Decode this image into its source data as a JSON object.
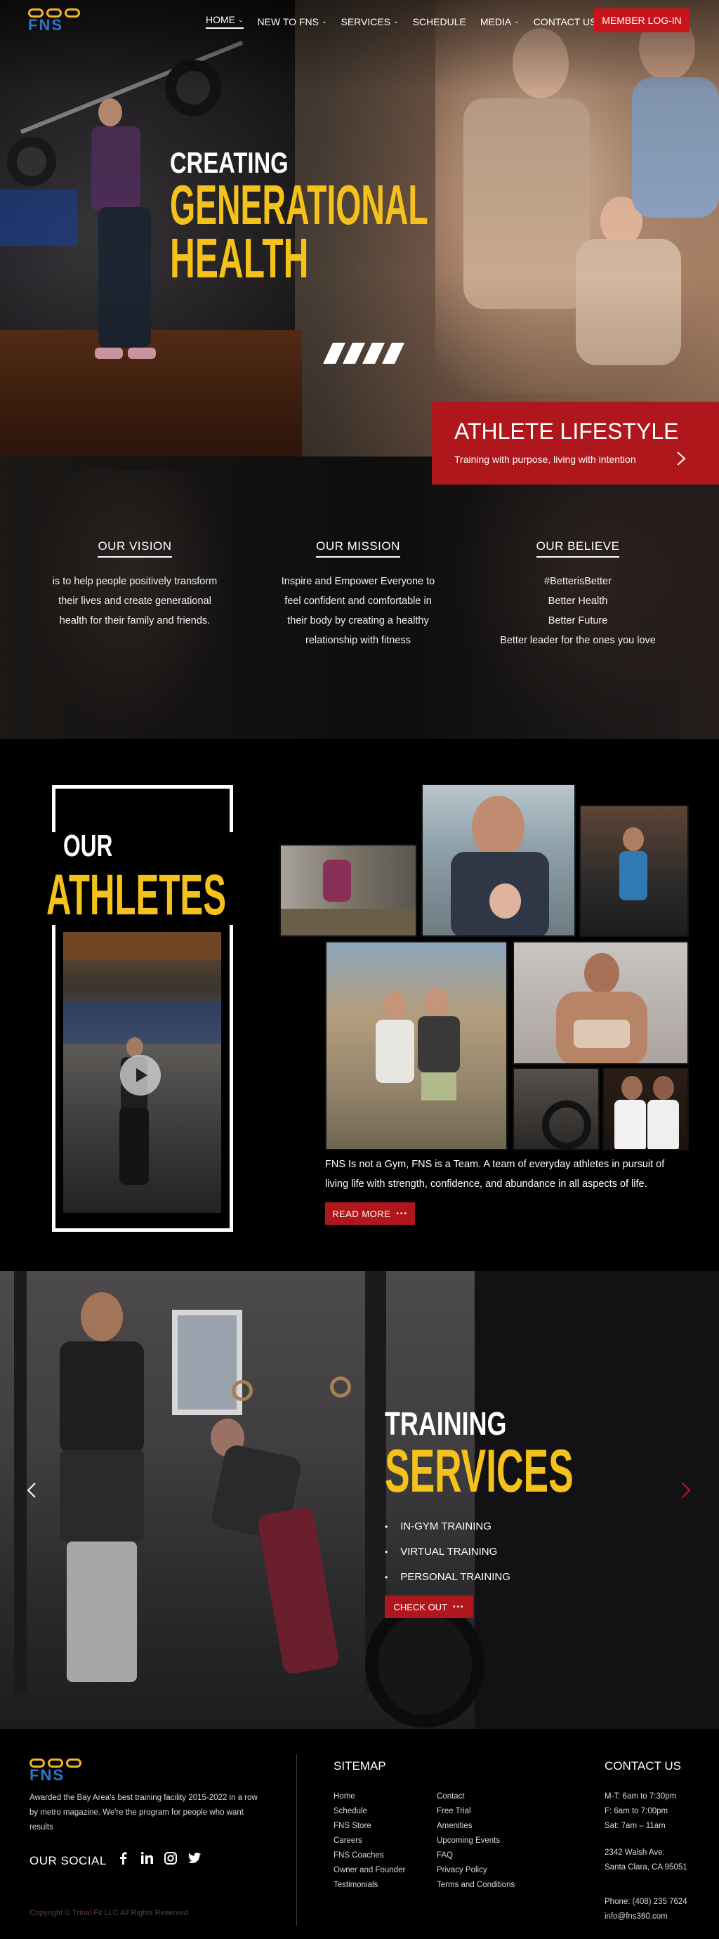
{
  "header": {
    "nav": [
      {
        "label": "HOME",
        "has_dropdown": true,
        "active": true
      },
      {
        "label": "NEW TO FNS",
        "has_dropdown": true
      },
      {
        "label": "SERVICES",
        "has_dropdown": true
      },
      {
        "label": "SCHEDULE",
        "has_dropdown": false
      },
      {
        "label": "MEDIA",
        "has_dropdown": true
      },
      {
        "label": "CONTACT US",
        "has_dropdown": false
      }
    ],
    "login_label": "MEMBER LOG-IN",
    "logo_text": "FNS"
  },
  "hero": {
    "line1": "CREATING",
    "line2": "GENERATIONAL",
    "line3": "HEALTH",
    "box_title": "ATHLETE LIFESTYLE",
    "box_subtitle": "Training with purpose, living with intention"
  },
  "values": [
    {
      "title": "OUR VISION",
      "lines": [
        "is to help people positively transform",
        "their lives and create generational",
        "health for their family and friends."
      ]
    },
    {
      "title": "OUR MISSION",
      "lines": [
        "Inspire and Empower Everyone to",
        "feel confident and comfortable in",
        "their body by creating a healthy",
        "relationship with fitness"
      ]
    },
    {
      "title": "OUR BELIEVE",
      "lines": [
        "#BetterisBetter",
        "Better Health",
        "Better Future",
        "Better leader for the ones you love"
      ]
    }
  ],
  "athletes": {
    "our": "OUR",
    "title": "ATHLETES",
    "description": "FNS Is not a Gym, FNS is a Team. A team of everyday athletes in pursuit of living life with strength, confidence, and abundance in all aspects of life.",
    "read_more": "READ MORE"
  },
  "training": {
    "title1": "TRAINING",
    "title2": "SERVICES",
    "items": [
      "IN-GYM TRAINING",
      "VIRTUAL TRAINING",
      "PERSONAL TRAINING"
    ],
    "checkout": "CHECK OUT"
  },
  "footer": {
    "award": "Awarded the Bay Area's best training facility 2015-2022 in a row by metro magazine. We're the program for people who want results",
    "social_label": "OUR SOCIAL",
    "copyright": "Copyright © Tribal Fit LLC All Rights Reserved",
    "sitemap_title": "SITEMAP",
    "sitemap_col1": [
      "Home",
      "Schedule",
      "FNS Store",
      "Careers",
      "FNS Coaches",
      "Owner and Founder",
      "Testimonials"
    ],
    "sitemap_col2": [
      "Contact",
      "Free Trial",
      "Amenities",
      "Upcoming Events",
      "FAQ",
      "Privacy Policy",
      "Terms and Conditions"
    ],
    "contact_title": "CONTACT US",
    "hours": [
      "M-T: 6am to 7:30pm",
      "F: 6am to 7:00pm",
      "Sat: 7am – 11am"
    ],
    "address": [
      "2342 Walsh Ave:",
      "Santa Clara, CA 95051"
    ],
    "phone": "Phone: (408) 235 7624",
    "email": "info@fns360.com"
  },
  "colors": {
    "accent_red": "#b0171d",
    "accent_yellow": "#f5c21b",
    "logo_blue": "#2b78c8"
  }
}
